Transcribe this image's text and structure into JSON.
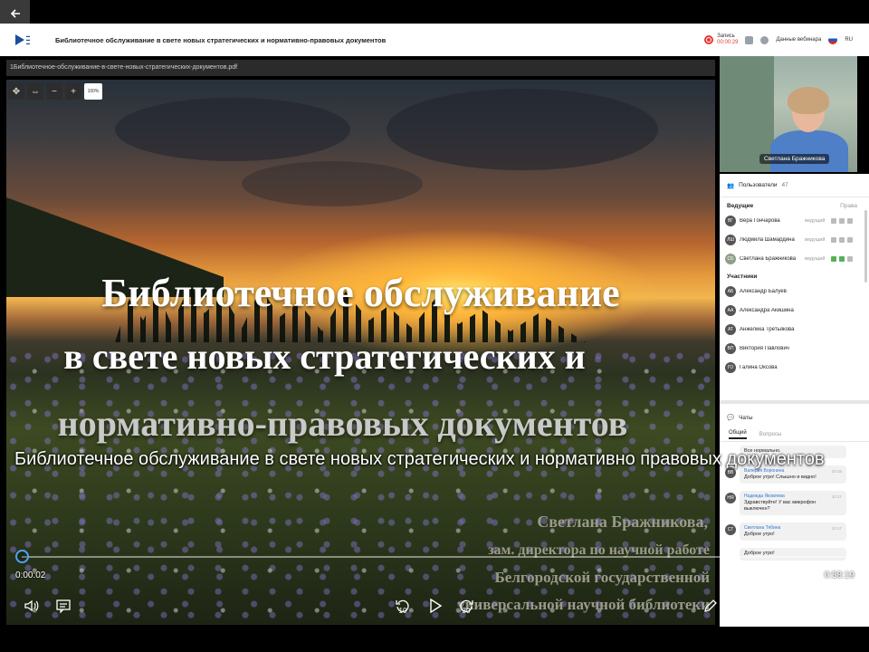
{
  "header": {
    "title": "Библиотечное обслуживание в свете новых стратегических и нормативно-правовых документов",
    "rec_label": "Запись",
    "rec_time": "00:00:29",
    "webinar_data": "Данные вебинара",
    "lang": "RU"
  },
  "presentation": {
    "filename": "1Библиотечное-обслуживание-в-свете-новых-стратегических-документов.pdf",
    "zoom": "100%",
    "slide_title": [
      "Библиотечное обслуживание",
      "в свете новых стратегических и",
      "нормативно-правовых документов"
    ],
    "slide_author": [
      "Светлана Бражникова,",
      "зам. директора по научной работе",
      "Белгородской государственной",
      "универсальной научной библиотеки"
    ]
  },
  "camera": {
    "name": "Светлана Бражникова"
  },
  "users": {
    "title": "Пользователи",
    "count": "47",
    "hosts_title": "Ведущие",
    "rights": "Права",
    "hosts": [
      {
        "initials": "ВГ",
        "name": "Вера Гончарова",
        "role": "ведущий"
      },
      {
        "initials": "ЛШ",
        "name": "Людмила Шамардина",
        "role": "ведущий"
      },
      {
        "initials": "СБ",
        "name": "Светлана Бражникова",
        "role": "ведущий"
      }
    ],
    "participants_title": "Участники",
    "participants": [
      {
        "initials": "АБ",
        "name": "Александр Балуев"
      },
      {
        "initials": "АА",
        "name": "Александра Акишина"
      },
      {
        "initials": "АТ",
        "name": "Анжелика Третьякова"
      },
      {
        "initials": "ВП",
        "name": "Виктория Павлович"
      },
      {
        "initials": "ГО",
        "name": "Галина Оксова"
      }
    ]
  },
  "chat": {
    "title": "Чаты",
    "tab_general": "Общий",
    "tab_questions": "Вопросы",
    "messages": [
      {
        "initials": "",
        "from": "",
        "time": "",
        "text": "Все нормально."
      },
      {
        "initials": "ВВ",
        "from": "Валерия Воронина",
        "time": "10:16",
        "text": "Доброе утро! Слышно и видно!"
      },
      {
        "initials": "НЯ",
        "from": "Надежда Яковлева",
        "time": "10:17",
        "text": "Здравствуйте! У вас микрофон выключен?"
      },
      {
        "initials": "СТ",
        "from": "Светлана Тябина",
        "time": "10:17",
        "text": "Доброе утро!"
      },
      {
        "initials": "",
        "from": "",
        "time": "",
        "text": "Доброе утро!"
      }
    ]
  },
  "player": {
    "subtitle": "Библиотечное обслуживание  в свете новых стратегических  и нормативно правовых документов",
    "current_time": "0:00:02",
    "total_time": "0:58:19",
    "progress": 0.001,
    "skip_back": "10",
    "skip_forward": "30",
    "accent": "#4da3ff"
  }
}
